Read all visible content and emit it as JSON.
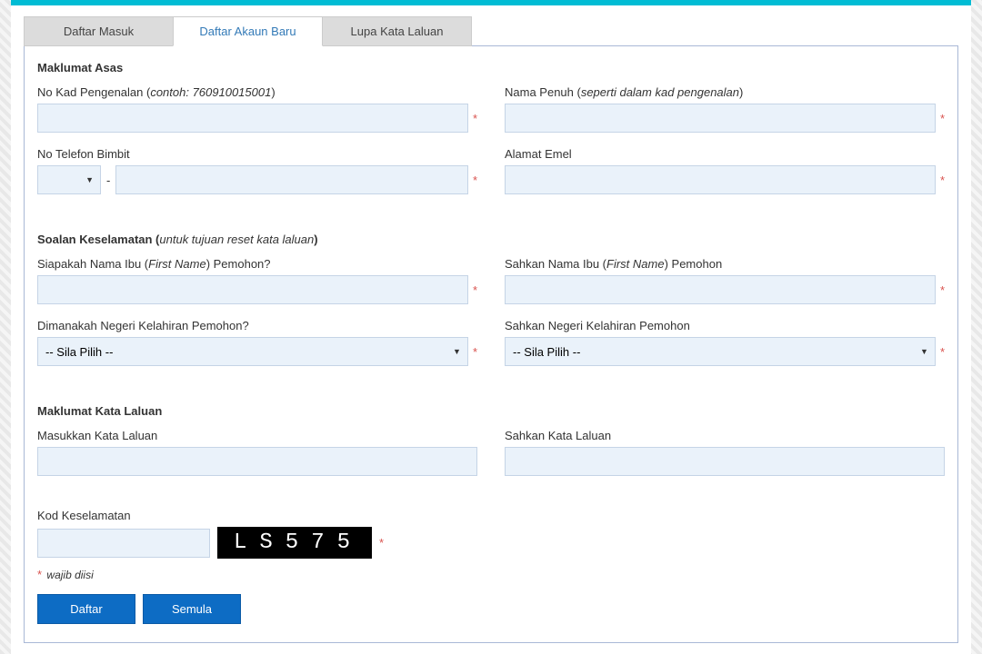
{
  "tabs": {
    "login": "Daftar Masuk",
    "register": "Daftar Akaun Baru",
    "forgot": "Lupa Kata Laluan"
  },
  "sections": {
    "basic": "Maklumat Asas",
    "security_prefix": "Soalan Keselamatan (",
    "security_hint": "untuk tujuan reset kata laluan",
    "security_suffix": ")",
    "password": "Maklumat Kata Laluan"
  },
  "labels": {
    "nric_prefix": "No Kad Pengenalan (",
    "nric_hint": "contoh: 760910015001",
    "nric_suffix": ")",
    "fullname_prefix": "Nama Penuh (",
    "fullname_hint": "seperti dalam kad pengenalan",
    "fullname_suffix": ")",
    "phone": "No Telefon Bimbit",
    "email": "Alamat Emel",
    "mother_prefix": "Siapakah Nama Ibu (",
    "mother_hint": "First Name",
    "mother_suffix": ") Pemohon?",
    "mother_conf_prefix": "Sahkan Nama Ibu (",
    "mother_conf_hint": "First Name",
    "mother_conf_suffix": ") Pemohon",
    "birth_state": "Dimanakah Negeri Kelahiran Pemohon?",
    "birth_state_conf": "Sahkan Negeri Kelahiran Pemohon",
    "password_enter": "Masukkan Kata Laluan",
    "password_conf": "Sahkan Kata Laluan",
    "captcha": "Kod Keselamatan"
  },
  "select": {
    "placeholder": "-- Sila Pilih --"
  },
  "captcha_code": "LS575",
  "mandatory": " wajib diisi",
  "star": "*",
  "buttons": {
    "submit": "Daftar",
    "reset": "Semula"
  }
}
